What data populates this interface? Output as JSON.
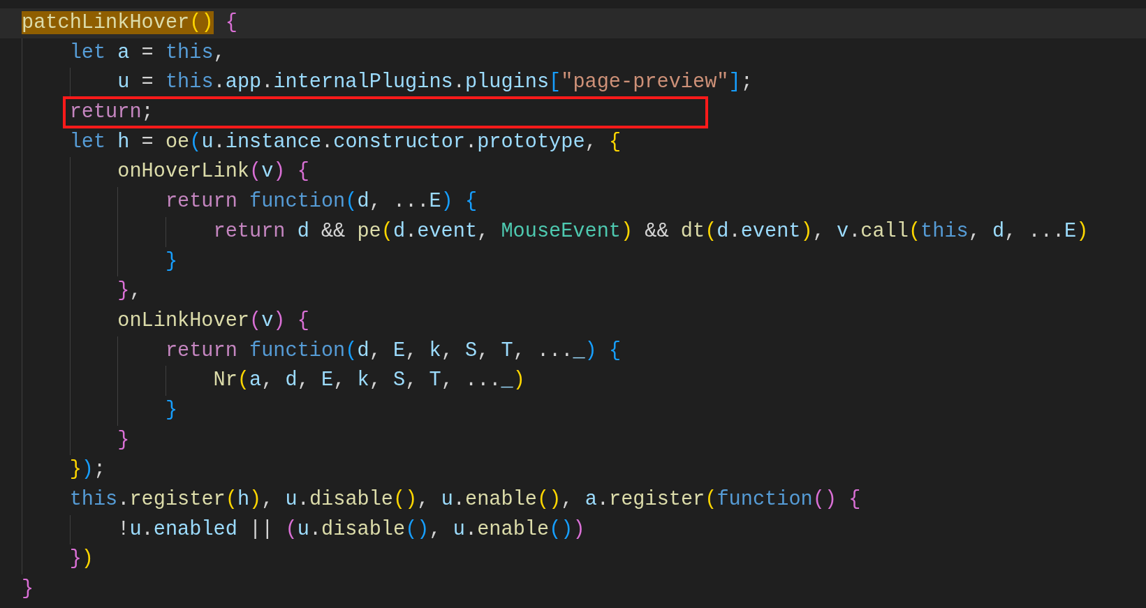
{
  "lines": [
    {
      "current": true,
      "boxed": false,
      "tokens": [
        {
          "text": "patchLinkHover",
          "kind": "match-function"
        },
        {
          "text": "()",
          "kind": "match-bracket-1"
        },
        {
          "text": " {",
          "kind": "bracket-2"
        }
      ],
      "children": [
        {
          "current": false,
          "boxed": false,
          "tokens": [
            {
              "text": "let",
              "kind": "keyword"
            },
            {
              "text": " a",
              "kind": "variable"
            },
            {
              "text": " = ",
              "kind": "punctuation"
            },
            {
              "text": "this",
              "kind": "keyword"
            },
            {
              "text": ",",
              "kind": "punctuation"
            }
          ],
          "children": [
            {
              "current": false,
              "boxed": false,
              "tokens": [
                {
                  "text": "u",
                  "kind": "variable"
                },
                {
                  "text": " = ",
                  "kind": "punctuation"
                },
                {
                  "text": "this",
                  "kind": "keyword"
                },
                {
                  "text": ".",
                  "kind": "punctuation"
                },
                {
                  "text": "app",
                  "kind": "variable"
                },
                {
                  "text": ".",
                  "kind": "punctuation"
                },
                {
                  "text": "internalPlugins",
                  "kind": "variable"
                },
                {
                  "text": ".",
                  "kind": "punctuation"
                },
                {
                  "text": "plugins",
                  "kind": "variable"
                },
                {
                  "text": "[",
                  "kind": "bracket-3"
                },
                {
                  "text": "\"page-preview\"",
                  "kind": "string"
                },
                {
                  "text": "]",
                  "kind": "bracket-3"
                },
                {
                  "text": ";",
                  "kind": "punctuation"
                }
              ]
            }
          ]
        },
        {
          "current": false,
          "boxed": true,
          "tokens": [
            {
              "text": "return",
              "kind": "control"
            },
            {
              "text": ";",
              "kind": "punctuation"
            }
          ]
        },
        {
          "current": false,
          "boxed": false,
          "tokens": [
            {
              "text": "let",
              "kind": "keyword"
            },
            {
              "text": " h",
              "kind": "variable"
            },
            {
              "text": " = ",
              "kind": "punctuation"
            },
            {
              "text": "oe",
              "kind": "function"
            },
            {
              "text": "(",
              "kind": "bracket-3"
            },
            {
              "text": "u",
              "kind": "variable"
            },
            {
              "text": ".",
              "kind": "punctuation"
            },
            {
              "text": "instance",
              "kind": "variable"
            },
            {
              "text": ".",
              "kind": "punctuation"
            },
            {
              "text": "constructor",
              "kind": "variable"
            },
            {
              "text": ".",
              "kind": "punctuation"
            },
            {
              "text": "prototype",
              "kind": "variable"
            },
            {
              "text": ", ",
              "kind": "punctuation"
            },
            {
              "text": "{",
              "kind": "bracket-1"
            }
          ],
          "children": [
            {
              "current": false,
              "boxed": false,
              "tokens": [
                {
                  "text": "onHoverLink",
                  "kind": "function"
                },
                {
                  "text": "(",
                  "kind": "bracket-2"
                },
                {
                  "text": "v",
                  "kind": "variable"
                },
                {
                  "text": ")",
                  "kind": "bracket-2"
                },
                {
                  "text": " {",
                  "kind": "bracket-2"
                }
              ],
              "children": [
                {
                  "current": false,
                  "boxed": false,
                  "tokens": [
                    {
                      "text": "return ",
                      "kind": "control"
                    },
                    {
                      "text": "function",
                      "kind": "keyword"
                    },
                    {
                      "text": "(",
                      "kind": "bracket-3"
                    },
                    {
                      "text": "d",
                      "kind": "variable"
                    },
                    {
                      "text": ", ...",
                      "kind": "punctuation"
                    },
                    {
                      "text": "E",
                      "kind": "variable"
                    },
                    {
                      "text": ")",
                      "kind": "bracket-3"
                    },
                    {
                      "text": " {",
                      "kind": "bracket-3"
                    }
                  ],
                  "children": [
                    {
                      "current": false,
                      "boxed": false,
                      "tokens": [
                        {
                          "text": "return ",
                          "kind": "control"
                        },
                        {
                          "text": "d",
                          "kind": "variable"
                        },
                        {
                          "text": " && ",
                          "kind": "punctuation"
                        },
                        {
                          "text": "pe",
                          "kind": "function"
                        },
                        {
                          "text": "(",
                          "kind": "bracket-1"
                        },
                        {
                          "text": "d",
                          "kind": "variable"
                        },
                        {
                          "text": ".",
                          "kind": "punctuation"
                        },
                        {
                          "text": "event",
                          "kind": "variable"
                        },
                        {
                          "text": ", ",
                          "kind": "punctuation"
                        },
                        {
                          "text": "MouseEvent",
                          "kind": "class"
                        },
                        {
                          "text": ")",
                          "kind": "bracket-1"
                        },
                        {
                          "text": " && ",
                          "kind": "punctuation"
                        },
                        {
                          "text": "dt",
                          "kind": "function"
                        },
                        {
                          "text": "(",
                          "kind": "bracket-1"
                        },
                        {
                          "text": "d",
                          "kind": "variable"
                        },
                        {
                          "text": ".",
                          "kind": "punctuation"
                        },
                        {
                          "text": "event",
                          "kind": "variable"
                        },
                        {
                          "text": ")",
                          "kind": "bracket-1"
                        },
                        {
                          "text": ", ",
                          "kind": "punctuation"
                        },
                        {
                          "text": "v",
                          "kind": "variable"
                        },
                        {
                          "text": ".",
                          "kind": "punctuation"
                        },
                        {
                          "text": "call",
                          "kind": "function"
                        },
                        {
                          "text": "(",
                          "kind": "bracket-1"
                        },
                        {
                          "text": "this",
                          "kind": "keyword"
                        },
                        {
                          "text": ", ",
                          "kind": "punctuation"
                        },
                        {
                          "text": "d",
                          "kind": "variable"
                        },
                        {
                          "text": ", ...",
                          "kind": "punctuation"
                        },
                        {
                          "text": "E",
                          "kind": "variable"
                        },
                        {
                          "text": ")",
                          "kind": "bracket-1"
                        }
                      ]
                    }
                  ]
                },
                {
                  "current": false,
                  "boxed": false,
                  "tokens": [
                    {
                      "text": "}",
                      "kind": "bracket-3"
                    }
                  ]
                }
              ]
            },
            {
              "current": false,
              "boxed": false,
              "tokens": [
                {
                  "text": "}",
                  "kind": "bracket-2"
                },
                {
                  "text": ",",
                  "kind": "punctuation"
                }
              ]
            },
            {
              "current": false,
              "boxed": false,
              "tokens": [
                {
                  "text": "onLinkHover",
                  "kind": "function"
                },
                {
                  "text": "(",
                  "kind": "bracket-2"
                },
                {
                  "text": "v",
                  "kind": "variable"
                },
                {
                  "text": ")",
                  "kind": "bracket-2"
                },
                {
                  "text": " {",
                  "kind": "bracket-2"
                }
              ],
              "children": [
                {
                  "current": false,
                  "boxed": false,
                  "tokens": [
                    {
                      "text": "return ",
                      "kind": "control"
                    },
                    {
                      "text": "function",
                      "kind": "keyword"
                    },
                    {
                      "text": "(",
                      "kind": "bracket-3"
                    },
                    {
                      "text": "d",
                      "kind": "variable"
                    },
                    {
                      "text": ", ",
                      "kind": "punctuation"
                    },
                    {
                      "text": "E",
                      "kind": "variable"
                    },
                    {
                      "text": ", ",
                      "kind": "punctuation"
                    },
                    {
                      "text": "k",
                      "kind": "variable"
                    },
                    {
                      "text": ", ",
                      "kind": "punctuation"
                    },
                    {
                      "text": "S",
                      "kind": "variable"
                    },
                    {
                      "text": ", ",
                      "kind": "punctuation"
                    },
                    {
                      "text": "T",
                      "kind": "variable"
                    },
                    {
                      "text": ", ...",
                      "kind": "punctuation"
                    },
                    {
                      "text": "_",
                      "kind": "variable"
                    },
                    {
                      "text": ")",
                      "kind": "bracket-3"
                    },
                    {
                      "text": " {",
                      "kind": "bracket-3"
                    }
                  ],
                  "children": [
                    {
                      "current": false,
                      "boxed": false,
                      "tokens": [
                        {
                          "text": "Nr",
                          "kind": "function"
                        },
                        {
                          "text": "(",
                          "kind": "bracket-1"
                        },
                        {
                          "text": "a",
                          "kind": "variable"
                        },
                        {
                          "text": ", ",
                          "kind": "punctuation"
                        },
                        {
                          "text": "d",
                          "kind": "variable"
                        },
                        {
                          "text": ", ",
                          "kind": "punctuation"
                        },
                        {
                          "text": "E",
                          "kind": "variable"
                        },
                        {
                          "text": ", ",
                          "kind": "punctuation"
                        },
                        {
                          "text": "k",
                          "kind": "variable"
                        },
                        {
                          "text": ", ",
                          "kind": "punctuation"
                        },
                        {
                          "text": "S",
                          "kind": "variable"
                        },
                        {
                          "text": ", ",
                          "kind": "punctuation"
                        },
                        {
                          "text": "T",
                          "kind": "variable"
                        },
                        {
                          "text": ", ...",
                          "kind": "punctuation"
                        },
                        {
                          "text": "_",
                          "kind": "variable"
                        },
                        {
                          "text": ")",
                          "kind": "bracket-1"
                        }
                      ]
                    }
                  ]
                },
                {
                  "current": false,
                  "boxed": false,
                  "tokens": [
                    {
                      "text": "}",
                      "kind": "bracket-3"
                    }
                  ]
                }
              ]
            },
            {
              "current": false,
              "boxed": false,
              "tokens": [
                {
                  "text": "}",
                  "kind": "bracket-2"
                }
              ]
            }
          ]
        },
        {
          "current": false,
          "boxed": false,
          "tokens": [
            {
              "text": "}",
              "kind": "bracket-1"
            },
            {
              "text": ")",
              "kind": "bracket-3"
            },
            {
              "text": ";",
              "kind": "punctuation"
            }
          ]
        },
        {
          "current": false,
          "boxed": false,
          "tokens": [
            {
              "text": "this",
              "kind": "keyword"
            },
            {
              "text": ".",
              "kind": "punctuation"
            },
            {
              "text": "register",
              "kind": "function"
            },
            {
              "text": "(",
              "kind": "bracket-1"
            },
            {
              "text": "h",
              "kind": "variable"
            },
            {
              "text": ")",
              "kind": "bracket-1"
            },
            {
              "text": ", ",
              "kind": "punctuation"
            },
            {
              "text": "u",
              "kind": "variable"
            },
            {
              "text": ".",
              "kind": "punctuation"
            },
            {
              "text": "disable",
              "kind": "function"
            },
            {
              "text": "()",
              "kind": "bracket-1"
            },
            {
              "text": ", ",
              "kind": "punctuation"
            },
            {
              "text": "u",
              "kind": "variable"
            },
            {
              "text": ".",
              "kind": "punctuation"
            },
            {
              "text": "enable",
              "kind": "function"
            },
            {
              "text": "()",
              "kind": "bracket-1"
            },
            {
              "text": ", ",
              "kind": "punctuation"
            },
            {
              "text": "a",
              "kind": "variable"
            },
            {
              "text": ".",
              "kind": "punctuation"
            },
            {
              "text": "register",
              "kind": "function"
            },
            {
              "text": "(",
              "kind": "bracket-1"
            },
            {
              "text": "function",
              "kind": "keyword"
            },
            {
              "text": "()",
              "kind": "bracket-2"
            },
            {
              "text": " {",
              "kind": "bracket-2"
            }
          ],
          "children": [
            {
              "current": false,
              "boxed": false,
              "tokens": [
                {
                  "text": "!",
                  "kind": "punctuation"
                },
                {
                  "text": "u",
                  "kind": "variable"
                },
                {
                  "text": ".",
                  "kind": "punctuation"
                },
                {
                  "text": "enabled",
                  "kind": "variable"
                },
                {
                  "text": " || ",
                  "kind": "punctuation"
                },
                {
                  "text": "(",
                  "kind": "bracket-2"
                },
                {
                  "text": "u",
                  "kind": "variable"
                },
                {
                  "text": ".",
                  "kind": "punctuation"
                },
                {
                  "text": "disable",
                  "kind": "function"
                },
                {
                  "text": "()",
                  "kind": "bracket-3"
                },
                {
                  "text": ", ",
                  "kind": "punctuation"
                },
                {
                  "text": "u",
                  "kind": "variable"
                },
                {
                  "text": ".",
                  "kind": "punctuation"
                },
                {
                  "text": "enable",
                  "kind": "function"
                },
                {
                  "text": "()",
                  "kind": "bracket-3"
                },
                {
                  "text": ")",
                  "kind": "bracket-2"
                }
              ]
            }
          ]
        },
        {
          "current": false,
          "boxed": false,
          "tokens": [
            {
              "text": "}",
              "kind": "bracket-2"
            },
            {
              "text": ")",
              "kind": "bracket-1"
            }
          ]
        }
      ]
    },
    {
      "current": false,
      "boxed": false,
      "tokens": [
        {
          "text": "}",
          "kind": "bracket-2"
        }
      ]
    }
  ]
}
